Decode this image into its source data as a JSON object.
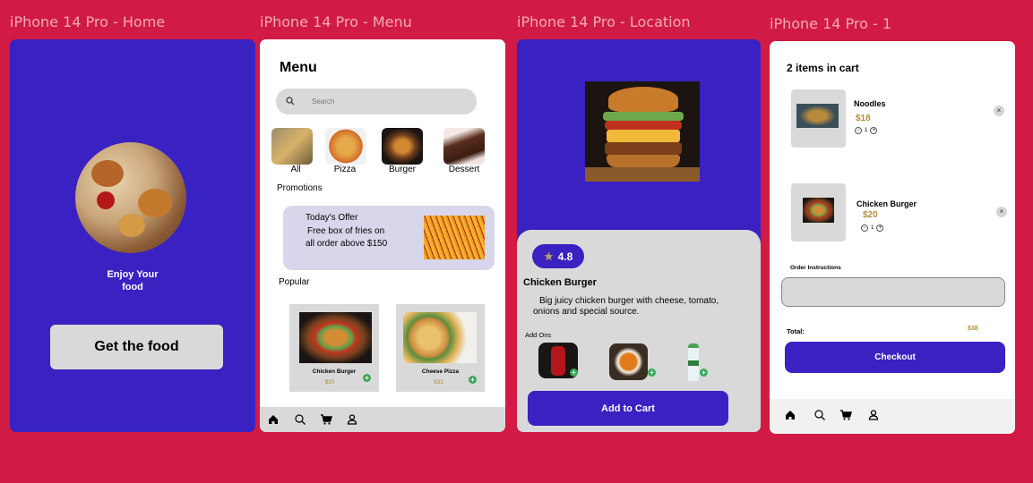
{
  "frames": {
    "home": {
      "label": "iPhone 14 Pro - Home"
    },
    "menu": {
      "label": "iPhone 14 Pro - Menu"
    },
    "location": {
      "label": "iPhone 14 Pro - Location"
    },
    "cart": {
      "label": "iPhone 14 Pro - 1"
    }
  },
  "home": {
    "tagline_line1": "Enjoy Your",
    "tagline_line2": "food",
    "cta_label": "Get the food"
  },
  "menu": {
    "title": "Menu",
    "search_placeholder": "Search",
    "categories": [
      {
        "label": "All"
      },
      {
        "label": "Pizza"
      },
      {
        "label": "Burger"
      },
      {
        "label": "Dessert"
      }
    ],
    "promotions_heading": "Promotions",
    "promo": {
      "line1": "Today's Offer",
      "line2": "Free box of  fries on",
      "line3": "all order above $150"
    },
    "popular_heading": "Popular",
    "popular": [
      {
        "name": "Chicken  Burger",
        "price": "$20"
      },
      {
        "name": "Cheese Pizza",
        "price": "$32"
      }
    ]
  },
  "location": {
    "rating": "4.8",
    "product_name": "Chicken Burger",
    "description_line1": "Big juicy chicken burger with cheese, tomato,",
    "description_line2": "onions and special source.",
    "addons_heading": "Add Ons",
    "cta_label": "Add to Cart"
  },
  "cart": {
    "title": "2 items in cart",
    "items": [
      {
        "name": "Noodles",
        "price": "$18",
        "qty": "1"
      },
      {
        "name": "Chicken Burger",
        "price": "$20",
        "qty": "1"
      }
    ],
    "instructions_label": "Order Instructions",
    "total_label": "Total:",
    "total_value": "$38",
    "checkout_label": "Checkout"
  },
  "icons": [
    "search-icon",
    "home-icon",
    "cart-icon",
    "user-icon",
    "star-icon",
    "close-icon",
    "plus-icon",
    "minus-icon"
  ],
  "colors": {
    "background": "#d11b45",
    "primary": "#3a21c2",
    "button_gray": "#d9d9d9",
    "price": "#b38c3a",
    "add_green": "#3aa857",
    "promo_bg": "#d8d6ea"
  }
}
